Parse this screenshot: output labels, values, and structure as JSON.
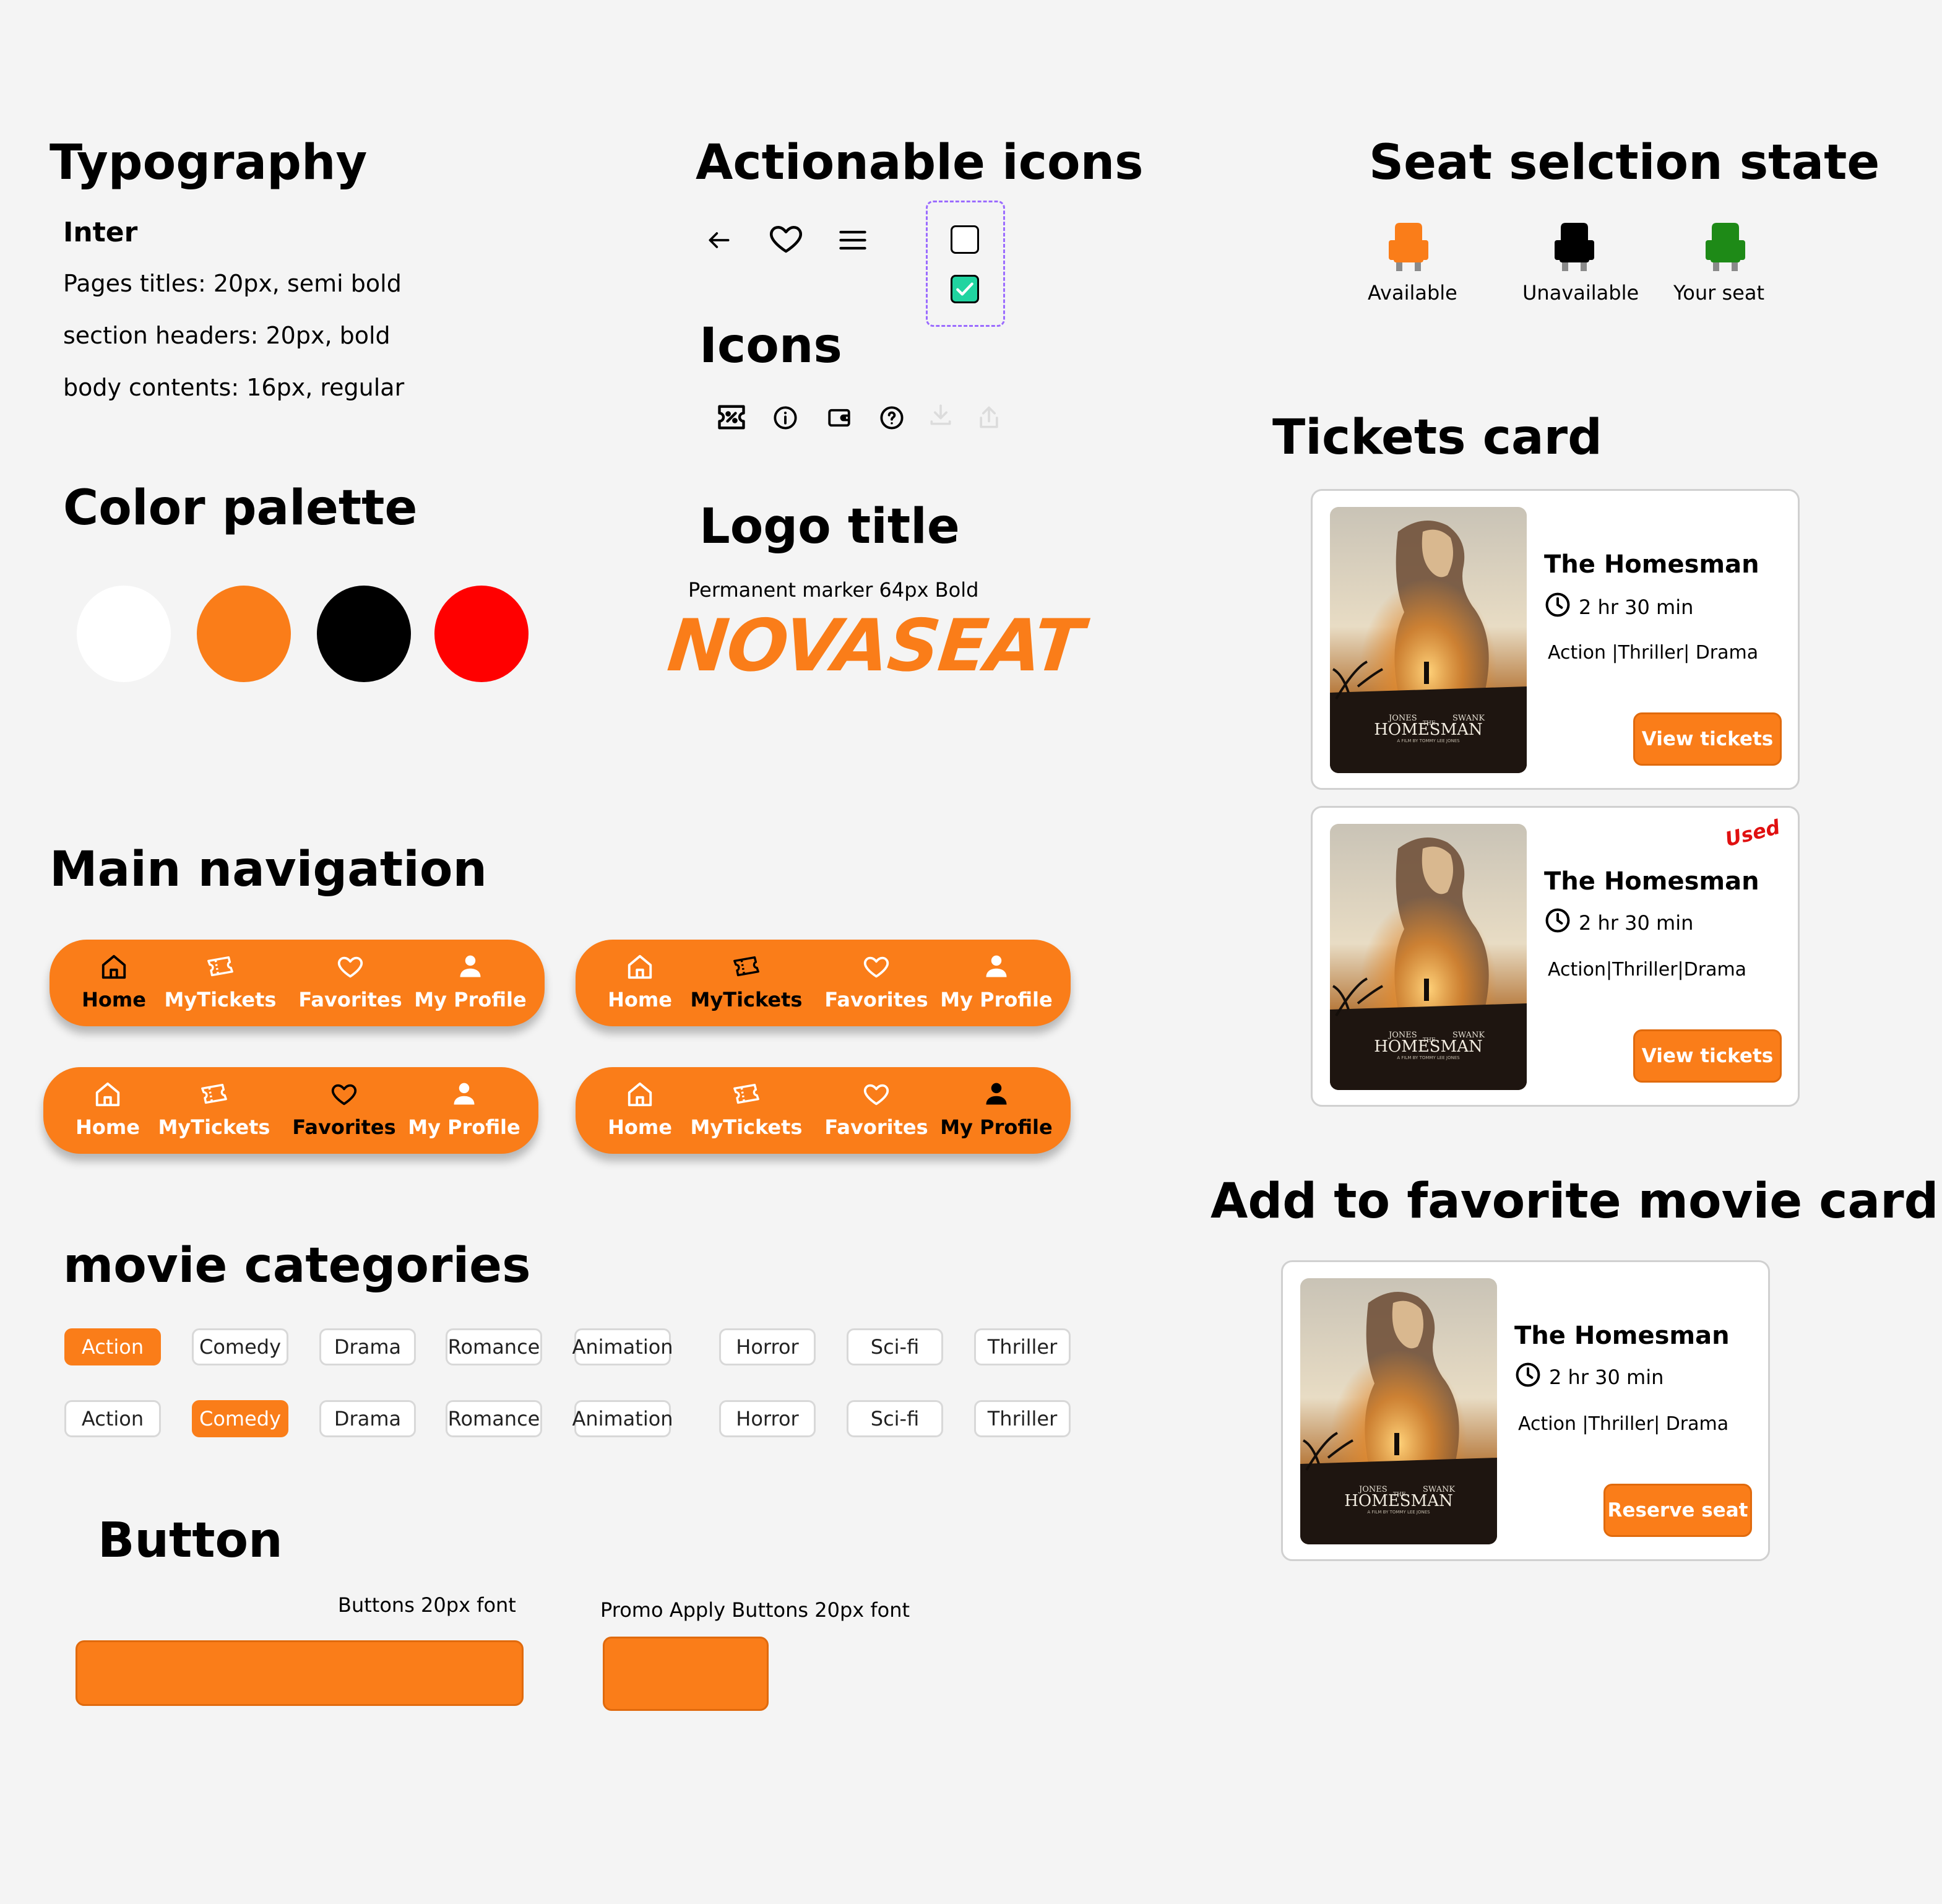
{
  "typography": {
    "heading": "Typography",
    "font": "Inter",
    "lines": [
      "Pages titles: 20px, semi bold",
      "section headers: 20px, bold",
      "body contents: 16px, regular"
    ]
  },
  "palette": {
    "heading": "Color palette",
    "colors": [
      "#ffffff",
      "#fa7d19",
      "#000000",
      "#ff0000"
    ]
  },
  "actionable_icons": {
    "heading": "Actionable icons",
    "icons": [
      "arrow-left-icon",
      "heart-icon",
      "menu-icon",
      "checkbox-unchecked-icon",
      "checkbox-checked-icon"
    ]
  },
  "icons_section": {
    "heading": "Icons",
    "icons": [
      "discount-ticket-icon",
      "info-icon",
      "wallet-icon",
      "help-icon",
      "download-icon",
      "share-icon"
    ]
  },
  "logo": {
    "heading": "Logo title",
    "caption": "Permanent marker 64px Bold",
    "text": "NOVASEAT",
    "color": "#fa7d19"
  },
  "seats": {
    "heading": "Seat selction state",
    "states": [
      {
        "label": "Available",
        "color": "#fa7d19"
      },
      {
        "label": "Unavailable",
        "color": "#000000"
      },
      {
        "label": "Your seat",
        "color": "#1e8a17"
      }
    ]
  },
  "navigation": {
    "heading": "Main navigation",
    "items": [
      "Home",
      "MyTickets",
      "Favorites",
      "My Profile"
    ],
    "icons": [
      "home-icon",
      "ticket-icon",
      "heart-icon",
      "profile-icon"
    ],
    "variants_active": [
      "Home",
      "MyTickets",
      "Favorites",
      "My Profile"
    ]
  },
  "categories": {
    "heading": "movie categories",
    "items": [
      "Action",
      "Comedy",
      "Drama",
      "Romance",
      "Animation",
      "Horror",
      "Sci-fi",
      "Thriller"
    ],
    "row_active": [
      "Action",
      "Comedy"
    ]
  },
  "button_section": {
    "heading": "Button",
    "caption_main": "Buttons 20px font",
    "caption_promo": "Promo Apply Buttons 20px font"
  },
  "tickets": {
    "heading": "Tickets card",
    "cards": [
      {
        "title": "The Homesman",
        "duration": "2 hr 30 min",
        "genres": "Action |Thriller| Drama",
        "button": "View tickets",
        "badge": ""
      },
      {
        "title": "The Homesman",
        "duration": "2 hr 30 min",
        "genres": "Action|Thriller|Drama",
        "button": "View tickets",
        "badge": "Used"
      }
    ]
  },
  "favorite": {
    "heading": "Add to favorite movie card",
    "card": {
      "title": "The Homesman",
      "duration": "2 hr 30 min",
      "genres": "Action |Thriller| Drama",
      "button": "Reserve seat"
    }
  },
  "poster": {
    "names_left": "JONES",
    "names_right": "SWANK",
    "small_the": "THE",
    "title": "HOMESMAN",
    "byline": "A FILM BY TOMMY LEE JONES"
  }
}
